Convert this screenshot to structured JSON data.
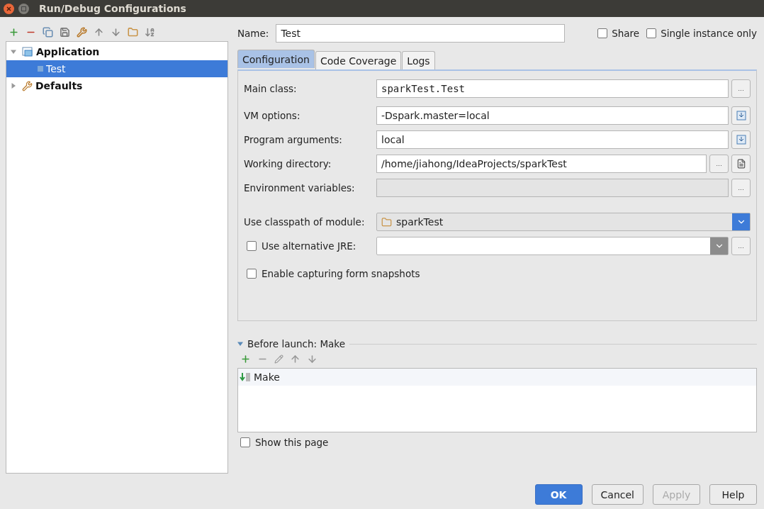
{
  "window": {
    "title": "Run/Debug Configurations"
  },
  "tree": [
    {
      "label": "Application",
      "expanded": true,
      "selected": false,
      "children": [
        {
          "label": "Test",
          "selected": true
        }
      ]
    },
    {
      "label": "Defaults",
      "expanded": false,
      "selected": false
    }
  ],
  "name_field": {
    "label": "Name:",
    "value": "Test"
  },
  "options": [
    {
      "label": "Share",
      "checked": false
    },
    {
      "label": "Single instance only",
      "checked": false
    }
  ],
  "tabs": [
    {
      "label": "Configuration",
      "selected": true
    },
    {
      "label": "Code Coverage",
      "selected": false
    },
    {
      "label": "Logs",
      "selected": false
    }
  ],
  "rows": [
    {
      "kind": "field",
      "label": "Main class:",
      "value": "sparkTest.Test",
      "monospace": true,
      "disabled": false,
      "buttons": [
        {
          "kind": "text",
          "text": "..."
        }
      ]
    },
    {
      "kind": "field",
      "label": "VM options:",
      "value": "-Dspark.master=local",
      "monospace": false,
      "disabled": false,
      "buttons": [
        {
          "kind": "expand"
        }
      ]
    },
    {
      "kind": "field",
      "label": "Program arguments:",
      "value": "local",
      "monospace": false,
      "disabled": false,
      "buttons": [
        {
          "kind": "expand"
        }
      ]
    },
    {
      "kind": "field",
      "label": "Working directory:",
      "value": "/home/jiahong/IdeaProjects/sparkTest",
      "monospace": false,
      "disabled": false,
      "buttons": [
        {
          "kind": "text",
          "text": "..."
        },
        {
          "kind": "document"
        }
      ]
    },
    {
      "kind": "field",
      "label": "Environment variables:",
      "monospace": false,
      "disabled": true,
      "buttons": [
        {
          "kind": "text",
          "text": "..."
        }
      ]
    },
    {
      "kind": "combo",
      "label": "Use classpath of module:",
      "value": "sparkTest"
    },
    {
      "kind": "check-combo",
      "label": "Use alternative JRE:",
      "checked": false,
      "buttons": [
        {
          "kind": "text",
          "text": "..."
        }
      ]
    },
    {
      "kind": "checkbox",
      "label": "Enable capturing form snapshots",
      "checked": false
    }
  ],
  "before_launch": {
    "title": "Before launch: Make",
    "expanded": true,
    "items": [
      {
        "label": "Make"
      }
    ],
    "show_page": {
      "label": "Show this page",
      "checked": false
    }
  },
  "buttons": [
    {
      "label": "OK",
      "kind": "primary"
    },
    {
      "label": "Cancel",
      "kind": "normal"
    },
    {
      "label": "Apply",
      "kind": "disabled"
    },
    {
      "label": "Help",
      "kind": "normal"
    }
  ]
}
